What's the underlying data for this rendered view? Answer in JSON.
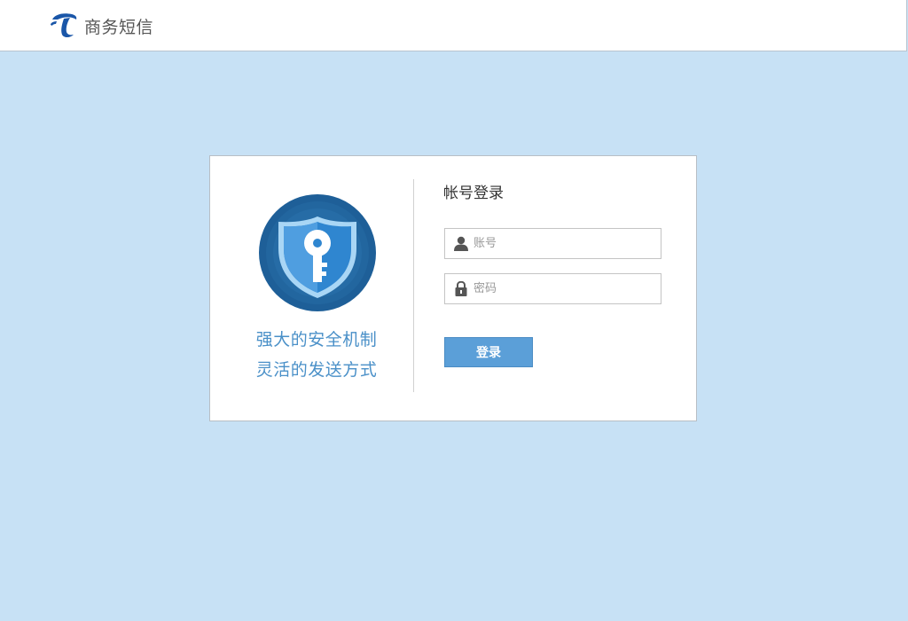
{
  "header": {
    "brand_name": "商务短信",
    "logo_icon": "telecom-logo-icon"
  },
  "promo": {
    "icon": "shield-key-icon",
    "line1": "强大的安全机制",
    "line2": "灵活的发送方式"
  },
  "login_form": {
    "title": "帐号登录",
    "account": {
      "icon": "user-icon",
      "placeholder": "账号",
      "value": ""
    },
    "password": {
      "icon": "lock-icon",
      "placeholder": "密码",
      "value": ""
    },
    "submit_label": "登录"
  },
  "colors": {
    "page_background": "#c7e1f5",
    "brand_blue": "#1a56a8",
    "accent_blue": "#5b9fd8",
    "slogan_blue": "#4a90c8"
  }
}
